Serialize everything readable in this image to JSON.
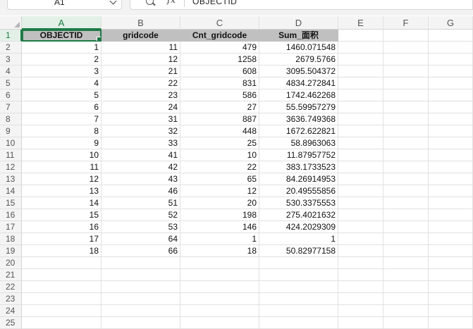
{
  "formula_bar": {
    "name_box": "A1",
    "formula": "OBJECTID",
    "zoom_icon": "zoom-icon",
    "fx_label": "fx"
  },
  "columns": [
    "A",
    "B",
    "C",
    "D",
    "E",
    "F",
    "G"
  ],
  "selected_column": "A",
  "selected_row": "1",
  "row_numbers": [
    "1",
    "2",
    "3",
    "4",
    "5",
    "6",
    "7",
    "8",
    "9",
    "10",
    "11",
    "12",
    "13",
    "14",
    "15",
    "16",
    "17",
    "18",
    "19",
    "20",
    "21",
    "22",
    "23",
    "24",
    "25"
  ],
  "headers": [
    "OBJECTID",
    "gridcode",
    "Cnt_gridcode",
    "Sum_面积"
  ],
  "rows": [
    [
      "1",
      "11",
      "479",
      "1460.071548"
    ],
    [
      "2",
      "12",
      "1258",
      "2679.5766"
    ],
    [
      "3",
      "21",
      "608",
      "3095.504372"
    ],
    [
      "4",
      "22",
      "831",
      "4834.272841"
    ],
    [
      "5",
      "23",
      "586",
      "1742.462268"
    ],
    [
      "6",
      "24",
      "27",
      "55.59957279"
    ],
    [
      "7",
      "31",
      "887",
      "3636.749368"
    ],
    [
      "8",
      "32",
      "448",
      "1672.622821"
    ],
    [
      "9",
      "33",
      "25",
      "58.8963063"
    ],
    [
      "10",
      "41",
      "10",
      "11.87957752"
    ],
    [
      "11",
      "42",
      "22",
      "383.1733523"
    ],
    [
      "12",
      "43",
      "65",
      "84.26914953"
    ],
    [
      "13",
      "46",
      "12",
      "20.49555856"
    ],
    [
      "14",
      "51",
      "20",
      "530.3375553"
    ],
    [
      "15",
      "52",
      "198",
      "275.4021632"
    ],
    [
      "16",
      "53",
      "146",
      "424.2029309"
    ],
    [
      "17",
      "64",
      "1",
      "1"
    ],
    [
      "18",
      "66",
      "18",
      "50.82977158"
    ]
  ]
}
